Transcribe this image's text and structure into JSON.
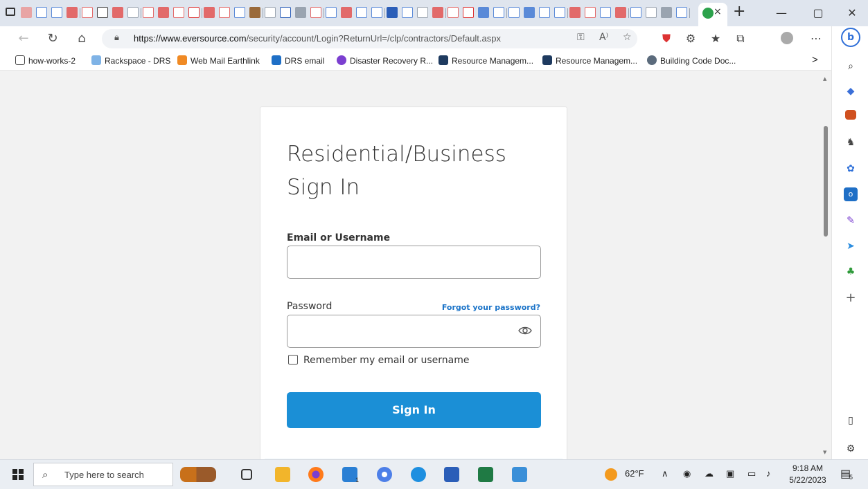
{
  "browser": {
    "tab_close": "×",
    "new_tab": "+",
    "window": {
      "minimize": "—",
      "restore": "▢",
      "close": "✕"
    },
    "url_host": "https://www.eversource.com",
    "url_path": "/security/account/Login?ReturnUrl=/clp/contractors/Default.aspx",
    "url_read_aloud": "A⁾",
    "favorites": [
      {
        "label": "how-works-2",
        "color": "#ffffff"
      },
      {
        "label": "Rackspace - DRS",
        "color": "#7fb3e6"
      },
      {
        "label": "Web Mail Earthlink",
        "color": "#f08a24"
      },
      {
        "label": "DRS email",
        "color": "#1f6fc6"
      },
      {
        "label": "Disaster Recovery R...",
        "color": "#7b3fd0"
      },
      {
        "label": "Resource Managem...",
        "color": "#1e3a5f"
      },
      {
        "label": "Resource Managem...",
        "color": "#1e3a5f"
      },
      {
        "label": "Building Code Doc...",
        "color": "#5b6b7c"
      }
    ],
    "favorites_more": ">"
  },
  "login": {
    "title": "Residential/Business Sign In",
    "email_label": "Email or Username",
    "email_value": "",
    "password_label": "Password",
    "password_value": "",
    "forgot_link": "Forgot your password?",
    "remember_label": "Remember my email or username",
    "sign_in_button": "Sign In"
  },
  "taskbar": {
    "search_placeholder": "Type here to search",
    "temperature": "62°F",
    "time": "9:18 AM",
    "date": "5/22/2023",
    "notification_count": "5",
    "mail_badge": "1"
  },
  "colors": {
    "accent": "#1b8fd6",
    "link": "#1a73c8"
  }
}
